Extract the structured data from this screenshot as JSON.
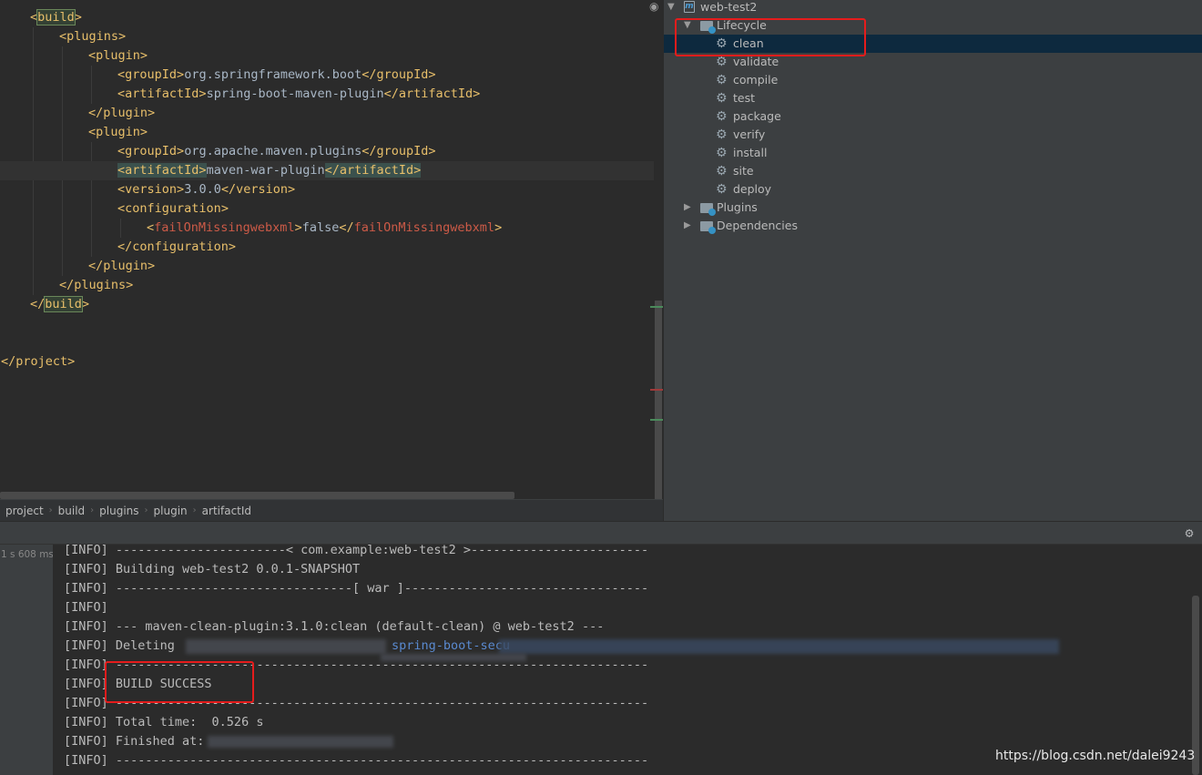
{
  "editor": {
    "lines": [
      {
        "open": "<",
        "name": "build",
        "close": ">"
      },
      {
        "open": "<",
        "name": "plugins",
        "close": ">"
      },
      {
        "open": "<",
        "name": "plugin",
        "close": ">"
      },
      {
        "open": "<",
        "name": "groupId",
        "close": ">",
        "text": "org.springframework.boot",
        "endtag": "</groupId>"
      },
      {
        "open": "<",
        "name": "artifactId",
        "close": ">",
        "text": "spring-boot-maven-plugin",
        "endtag": "</artifactId>"
      },
      {
        "endtag": "</plugin>"
      },
      {
        "open": "<",
        "name": "plugin",
        "close": ">"
      },
      {
        "open": "<",
        "name": "groupId",
        "close": ">",
        "text": "org.apache.maven.plugins",
        "endtag": "</groupId>"
      },
      {
        "open": "<",
        "name": "artifactId",
        "close": ">",
        "text": "maven-war-plugin",
        "endtag": "</artifactId>"
      },
      {
        "open": "<",
        "name": "version",
        "close": ">",
        "text": "3.0.0",
        "endtag": "</version>"
      },
      {
        "open": "<",
        "name": "configuration",
        "close": ">"
      },
      {
        "open": "<",
        "name": "failOnMissingwebxml",
        "close": ">",
        "text": "false",
        "endtag_open": "</",
        "endtag_name": "failOnMissingwebxml",
        "endtag_close": ">"
      },
      {
        "endtag": "</configuration>"
      },
      {
        "endtag": "</plugin>"
      },
      {
        "endtag": "</plugins>"
      },
      {
        "endtag_open": "</",
        "endtag_name": "build",
        "endtag_close": ">"
      },
      {
        "endtag": "</project>"
      }
    ]
  },
  "breadcrumb": [
    "project",
    "build",
    "plugins",
    "plugin",
    "artifactId"
  ],
  "maven": {
    "project": "web-test2",
    "lifecycle_label": "Lifecycle",
    "goals": [
      "clean",
      "validate",
      "compile",
      "test",
      "package",
      "verify",
      "install",
      "site",
      "deploy"
    ],
    "plugins_label": "Plugins",
    "dependencies_label": "Dependencies",
    "selected_goal": "clean"
  },
  "run": {
    "duration": "1 s 608 ms",
    "lines": [
      "[INFO] -----------------------< com.example:web-test2 >------------------------",
      "[INFO] Building web-test2 0.0.1-SNAPSHOT",
      "[INFO] --------------------------------[ war ]---------------------------------",
      "[INFO]",
      "[INFO] --- maven-clean-plugin:3.1.0:clean (default-clean) @ web-test2 ---",
      "[INFO] Deleting",
      "[INFO] ------------------------------------------------------------------------",
      "[INFO] BUILD SUCCESS",
      "[INFO] ------------------------------------------------------------------------",
      "[INFO] Total time:  0.526 s",
      "[INFO] Finished at:",
      "[INFO] ------------------------------------------------------------------------"
    ],
    "deleting_fragment": "spring-boot-secu"
  },
  "watermark": "https://blog.csdn.net/dalei9243",
  "colors": {
    "editor_bg": "#2b2b2b",
    "panel_bg": "#3c3f41",
    "tag": "#e8bf6a",
    "tag_error": "#cc5a47",
    "highlight_box": "#e51c1c",
    "selection": "#0d293e"
  }
}
